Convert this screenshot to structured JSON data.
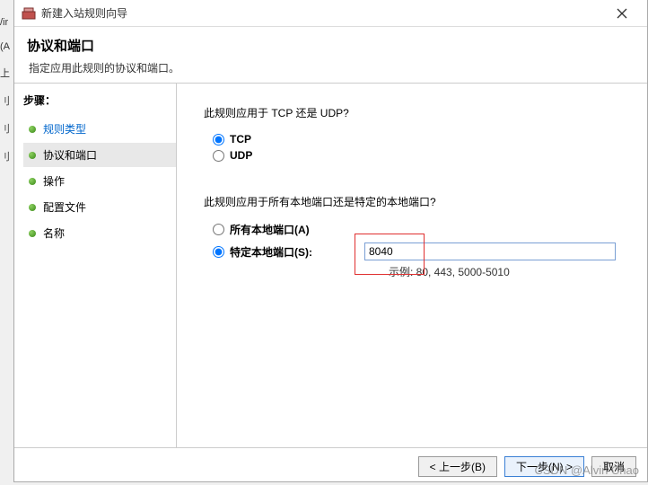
{
  "left_strip": {
    "a": "/ir",
    "b": "(A",
    "c": "上",
    "d": "刂",
    "e": "刂",
    "f": "刂"
  },
  "title": "新建入站规则向导",
  "header": {
    "title": "协议和端口",
    "subtitle": "指定应用此规则的协议和端口。"
  },
  "sidebar": {
    "steps_label": "步骤：",
    "items": [
      {
        "label": "规则类型"
      },
      {
        "label": "协议和端口"
      },
      {
        "label": "操作"
      },
      {
        "label": "配置文件"
      },
      {
        "label": "名称"
      }
    ]
  },
  "main": {
    "q1": "此规则应用于 TCP 还是 UDP?",
    "tcp": "TCP",
    "udp": "UDP",
    "q2": "此规则应用于所有本地端口还是特定的本地端口?",
    "all_ports": "所有本地端口(A)",
    "specific_ports": "特定本地端口(S):",
    "port_value": "8040",
    "example": "示例: 80, 443, 5000-5010"
  },
  "footer": {
    "back": "< 上一步(B)",
    "next": "下一步(N) >",
    "cancel": "取消"
  },
  "watermark": "CSDN @Alvin Chao"
}
